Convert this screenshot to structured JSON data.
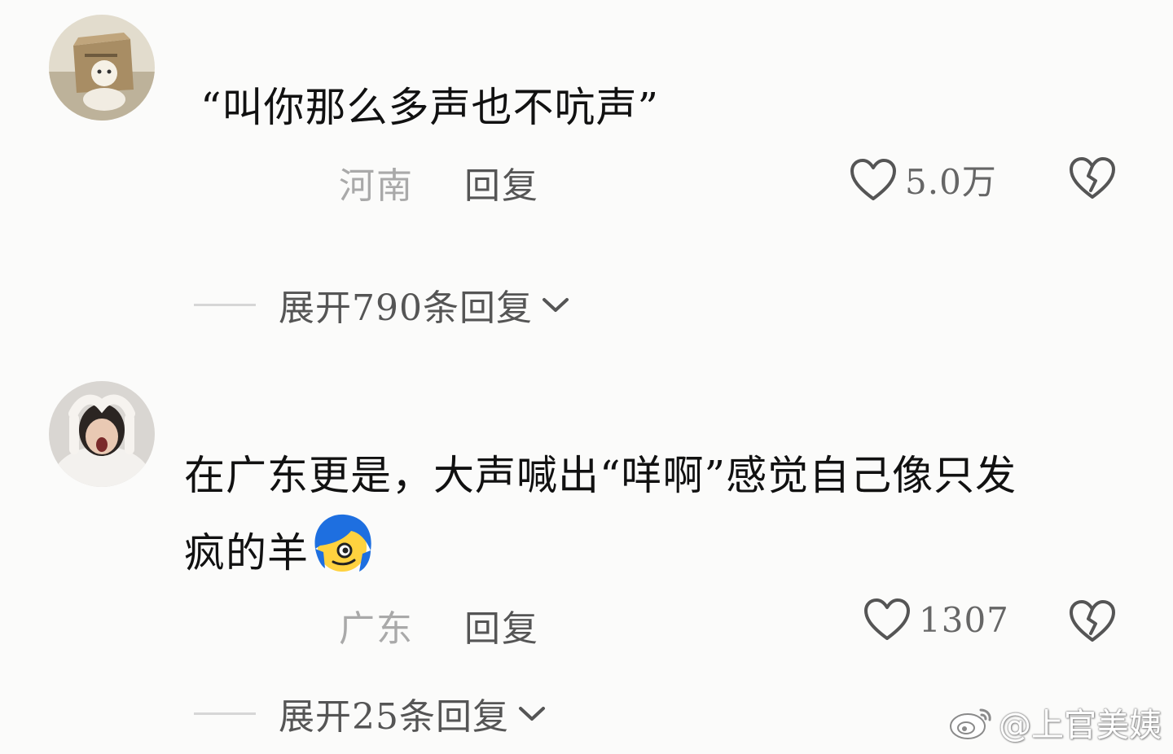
{
  "comments": [
    {
      "avatar_icon": "avatar-bear-toy-icon",
      "text": "“叫你那么多声也不吭声”",
      "location": "河南",
      "reply_label": "回复",
      "likes": "5.0万",
      "expand_label": "展开790条回复"
    },
    {
      "avatar_icon": "avatar-screaming-person-icon",
      "text_line1": "在广东更是，大声喊出“咩啊”感觉自己像只发",
      "text_line2": "疯的羊",
      "emoji_icon": "blue-hair-emoji-icon",
      "location": "广东",
      "reply_label": "回复",
      "likes": "1307",
      "expand_label": "展开25条回复"
    }
  ],
  "watermark": {
    "icon": "weibo-logo-icon",
    "text": "@上官美姨"
  },
  "colors": {
    "background": "#fbfbfa",
    "text": "#111111",
    "location": "#a9a9a9",
    "meta": "#555555",
    "emoji_hair": "#1e6fe0",
    "emoji_face": "#ffd23f"
  }
}
